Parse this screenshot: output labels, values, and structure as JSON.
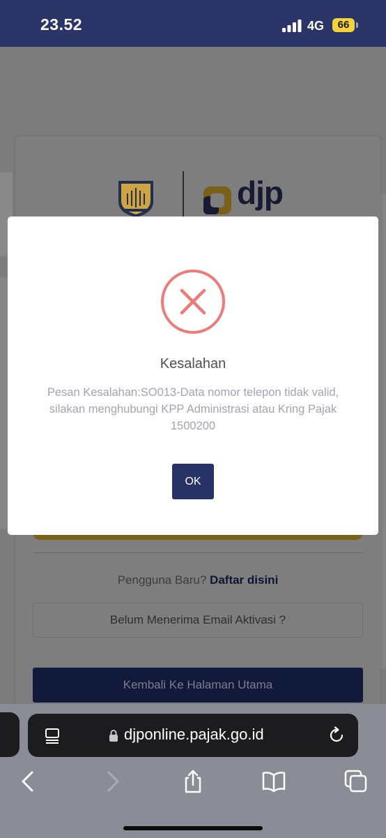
{
  "status_bar": {
    "time": "23.52",
    "network": "4G",
    "battery": "66",
    "icons": [
      "signal-icon",
      "battery-icon"
    ]
  },
  "page": {
    "logos": [
      "kemenkeu-logo",
      "djp-logo"
    ],
    "brand_text": "djp",
    "register_prompt": "Pengguna Baru?",
    "register_link": "Daftar disini",
    "resend_activation_label": "Belum Menerima Email Aktivasi ?",
    "back_home_label": "Kembali Ke Halaman Utama"
  },
  "modal": {
    "icon": "error-x-icon",
    "title": "Kesalahan",
    "message": "Pesan Kesalahan:SO013-Data nomor telepon tidak valid, silakan menghubungi KPP Administrasi atau Kring Pajak 1500200",
    "ok_label": "OK",
    "colors": {
      "error": "#ef7a7a",
      "button": "#273266"
    }
  },
  "browser": {
    "url": "djponline.pajak.go.id",
    "icons": [
      "page-menu-icon",
      "lock-icon",
      "reload-icon",
      "back-icon",
      "forward-icon",
      "share-icon",
      "bookmarks-icon",
      "tabs-icon"
    ]
  }
}
